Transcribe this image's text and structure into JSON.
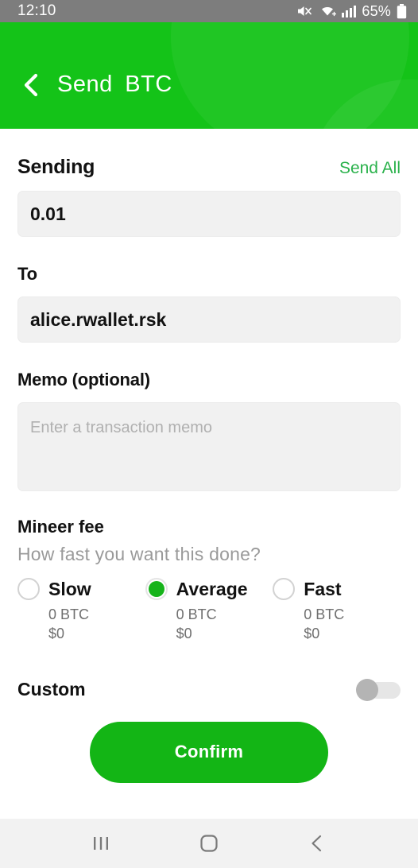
{
  "status_bar": {
    "time": "12:10",
    "battery_text": "65%",
    "icons": [
      "mute-icon",
      "wifi-icon",
      "signal-icon",
      "battery-icon"
    ]
  },
  "header": {
    "title": "Send  BTC",
    "back_icon": "back-chevron-icon",
    "background_color": "#14c318"
  },
  "sending": {
    "label": "Sending",
    "send_all_label": "Send All",
    "amount_value": "0.01"
  },
  "to": {
    "label": "To",
    "address_value": "alice.rwallet.rsk"
  },
  "memo": {
    "label": "Memo (optional)",
    "placeholder": "Enter a transaction memo",
    "value": ""
  },
  "fee": {
    "title": "Mineer fee",
    "subtitle": "How fast you want this done?",
    "selected": "Average",
    "options": [
      {
        "label": "Slow",
        "btc": "0 BTC",
        "fiat": "$0",
        "selected": false
      },
      {
        "label": "Average",
        "btc": "0 BTC",
        "fiat": "$0",
        "selected": true
      },
      {
        "label": "Fast",
        "btc": "0 BTC",
        "fiat": "$0",
        "selected": false
      }
    ]
  },
  "custom": {
    "label": "Custom",
    "enabled": false
  },
  "confirm": {
    "label": "Confirm",
    "color": "#13b515"
  },
  "nav_bar": {
    "recents_icon": "recents-icon",
    "home_icon": "home-icon",
    "back_icon": "back-icon"
  },
  "colors": {
    "brand_green": "#14c318",
    "link_green": "#2bb24c",
    "field_gray": "#f1f1f1"
  }
}
